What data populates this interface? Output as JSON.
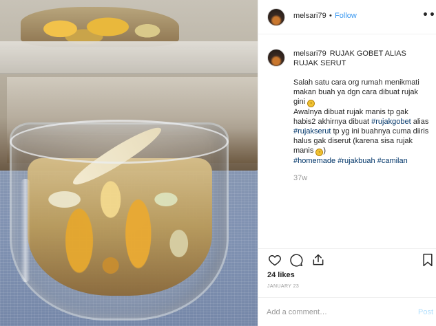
{
  "post": {
    "username": "melsari79",
    "follow_label": "Follow",
    "separator": "•",
    "more_label": "•••",
    "caption": {
      "title": "RUJAK GOBET ALIAS RUJAK SERUT",
      "line1": "Salah satu cara org rumah menikmati makan buah ya dgn cara dibuat rujak gini",
      "line2_a": "Awalnya dibuat rujak manis tp gak habis2 akhirnya dibuat",
      "tag_rujakgobet": "#rujakgobet",
      "line2_b": "alias",
      "tag_rujakserut": "#rujakserut",
      "line2_c": "tp yg ini buahnya cuma diiris halus gak diserut (karena sisa rujak manis",
      "line2_d": ")",
      "tag_homemade": "#homemade",
      "tag_rujakbuah": "#rujakbuah",
      "tag_camilan": "#camilan"
    },
    "time_ago": "37w",
    "likes": "24 likes",
    "date": "JANUARY 23",
    "comment_placeholder": "Add a comment…",
    "post_label": "Post",
    "colors": {
      "link_blue": "#3897f0",
      "hashtag": "#003569",
      "muted": "#999999",
      "post_disabled": "#b2dffc"
    },
    "icons": [
      "heart-icon",
      "comment-icon",
      "share-icon",
      "bookmark-icon",
      "emoji-grin-icon"
    ]
  }
}
